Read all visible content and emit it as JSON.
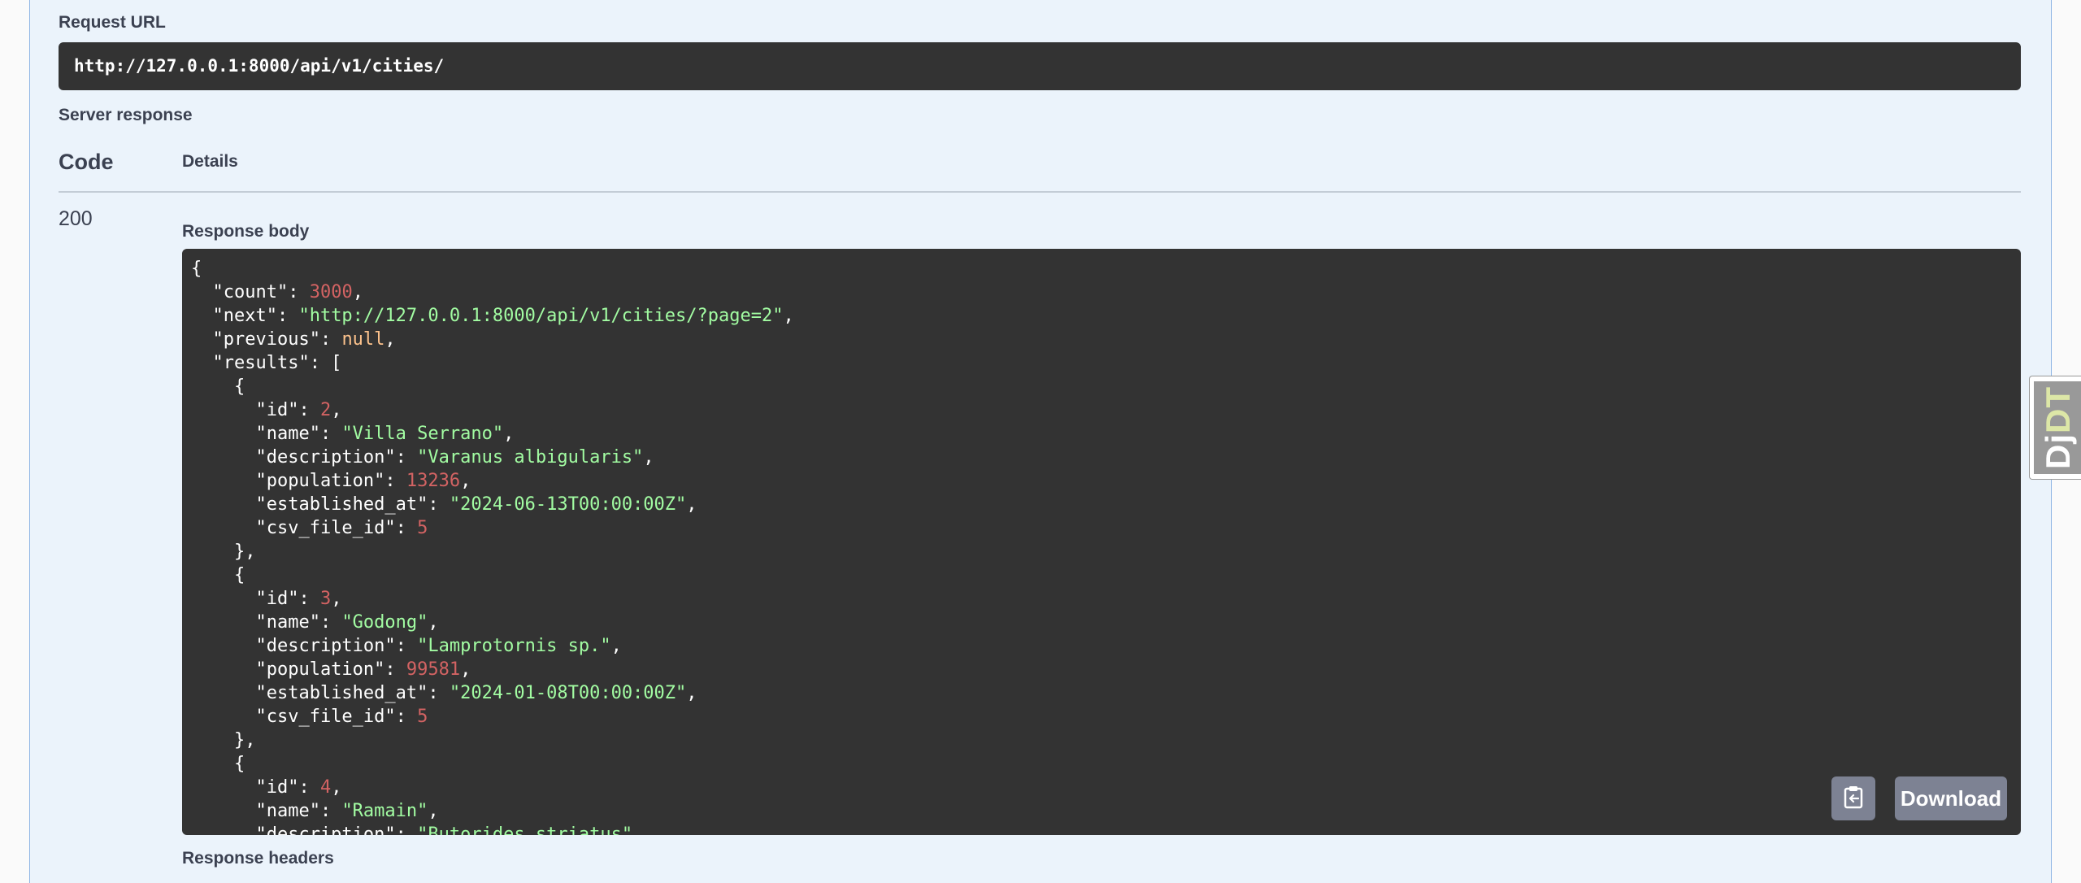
{
  "request_url": {
    "label": "Request URL",
    "value": "http://127.0.0.1:8000/api/v1/cities/"
  },
  "server_response": {
    "label": "Server response",
    "columns": {
      "code": "Code",
      "details": "Details"
    },
    "status_code": "200",
    "response_body_label": "Response body",
    "response_headers_label": "Response headers",
    "body_lines": [
      [
        {
          "t": "p",
          "v": "{"
        }
      ],
      [
        {
          "t": "p",
          "v": "  \"count\": "
        },
        {
          "t": "num",
          "v": "3000"
        },
        {
          "t": "p",
          "v": ","
        }
      ],
      [
        {
          "t": "p",
          "v": "  \"next\": "
        },
        {
          "t": "str",
          "v": "\"http://127.0.0.1:8000/api/v1/cities/?page=2\""
        },
        {
          "t": "p",
          "v": ","
        }
      ],
      [
        {
          "t": "p",
          "v": "  \"previous\": "
        },
        {
          "t": "null",
          "v": "null"
        },
        {
          "t": "p",
          "v": ","
        }
      ],
      [
        {
          "t": "p",
          "v": "  \"results\": ["
        }
      ],
      [
        {
          "t": "p",
          "v": "    {"
        }
      ],
      [
        {
          "t": "p",
          "v": "      \"id\": "
        },
        {
          "t": "num",
          "v": "2"
        },
        {
          "t": "p",
          "v": ","
        }
      ],
      [
        {
          "t": "p",
          "v": "      \"name\": "
        },
        {
          "t": "str",
          "v": "\"Villa Serrano\""
        },
        {
          "t": "p",
          "v": ","
        }
      ],
      [
        {
          "t": "p",
          "v": "      \"description\": "
        },
        {
          "t": "str",
          "v": "\"Varanus albigularis\""
        },
        {
          "t": "p",
          "v": ","
        }
      ],
      [
        {
          "t": "p",
          "v": "      \"population\": "
        },
        {
          "t": "num",
          "v": "13236"
        },
        {
          "t": "p",
          "v": ","
        }
      ],
      [
        {
          "t": "p",
          "v": "      \"established_at\": "
        },
        {
          "t": "str",
          "v": "\"2024-06-13T00:00:00Z\""
        },
        {
          "t": "p",
          "v": ","
        }
      ],
      [
        {
          "t": "p",
          "v": "      \"csv_file_id\": "
        },
        {
          "t": "num",
          "v": "5"
        }
      ],
      [
        {
          "t": "p",
          "v": "    },"
        }
      ],
      [
        {
          "t": "p",
          "v": "    {"
        }
      ],
      [
        {
          "t": "p",
          "v": "      \"id\": "
        },
        {
          "t": "num",
          "v": "3"
        },
        {
          "t": "p",
          "v": ","
        }
      ],
      [
        {
          "t": "p",
          "v": "      \"name\": "
        },
        {
          "t": "str",
          "v": "\"Godong\""
        },
        {
          "t": "p",
          "v": ","
        }
      ],
      [
        {
          "t": "p",
          "v": "      \"description\": "
        },
        {
          "t": "str",
          "v": "\"Lamprotornis sp.\""
        },
        {
          "t": "p",
          "v": ","
        }
      ],
      [
        {
          "t": "p",
          "v": "      \"population\": "
        },
        {
          "t": "num",
          "v": "99581"
        },
        {
          "t": "p",
          "v": ","
        }
      ],
      [
        {
          "t": "p",
          "v": "      \"established_at\": "
        },
        {
          "t": "str",
          "v": "\"2024-01-08T00:00:00Z\""
        },
        {
          "t": "p",
          "v": ","
        }
      ],
      [
        {
          "t": "p",
          "v": "      \"csv_file_id\": "
        },
        {
          "t": "num",
          "v": "5"
        }
      ],
      [
        {
          "t": "p",
          "v": "    },"
        }
      ],
      [
        {
          "t": "p",
          "v": "    {"
        }
      ],
      [
        {
          "t": "p",
          "v": "      \"id\": "
        },
        {
          "t": "num",
          "v": "4"
        },
        {
          "t": "p",
          "v": ","
        }
      ],
      [
        {
          "t": "p",
          "v": "      \"name\": "
        },
        {
          "t": "str",
          "v": "\"Ramain\""
        },
        {
          "t": "p",
          "v": ","
        }
      ],
      [
        {
          "t": "p",
          "v": "      \"description\": "
        },
        {
          "t": "str",
          "v": "\"Butorides striatus\""
        },
        {
          "t": "p",
          "v": ","
        }
      ]
    ],
    "copy_icon": "clipboard-copy-icon",
    "download_label": "Download"
  },
  "debug_toolbar": {
    "part1": "Dj",
    "part2": "DT"
  },
  "colors": {
    "panel_bg": "#ebf3fb",
    "code_bg": "#333333",
    "number": "#d36363",
    "string": "#a2fca2",
    "null": "#fcc28c",
    "button_bg": "#7d8293"
  }
}
